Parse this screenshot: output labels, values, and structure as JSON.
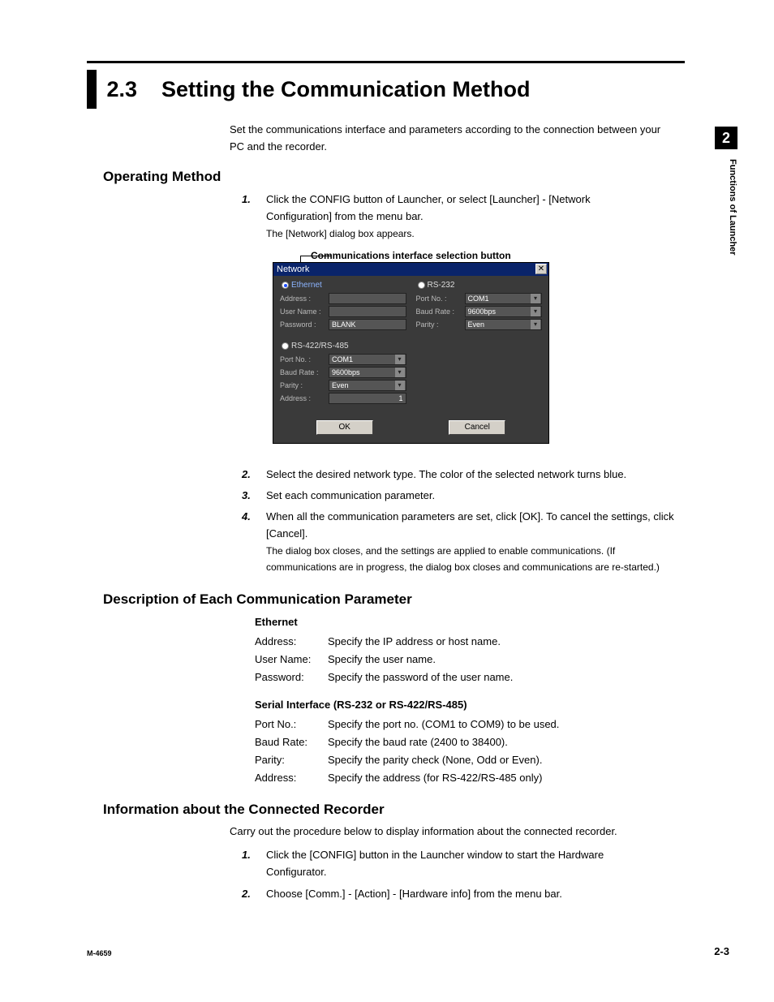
{
  "section_number": "2.3",
  "section_title": "Setting the Communication Method",
  "intro": "Set the communications interface and parameters according to the connection between your PC and the recorder.",
  "side_tab": "2",
  "side_label": "Functions of Launcher",
  "operating_method": {
    "heading": "Operating Method",
    "steps": [
      {
        "num": "1.",
        "text": "Click the CONFIG button of Launcher, or select [Launcher] - [Network Configuration] from the menu bar.",
        "note": "The [Network] dialog box appears."
      },
      {
        "num": "2.",
        "text": "Select the desired network type.  The color of the selected network turns blue."
      },
      {
        "num": "3.",
        "text": "Set each communication parameter."
      },
      {
        "num": "4.",
        "text": "When all the communication parameters are set, click [OK].  To cancel the settings, click [Cancel].",
        "note": "The dialog box closes, and the settings are applied to enable communications.  (If communications are in progress, the dialog box closes and communications are re-started.)"
      }
    ]
  },
  "callout": "Communications interface selection button",
  "dialog": {
    "title": "Network",
    "ethernet": {
      "title": "Ethernet",
      "address_label": "Address :",
      "address_value": "",
      "username_label": "User Name :",
      "username_value": "",
      "password_label": "Password :",
      "password_value": "BLANK"
    },
    "rs422": {
      "title": "RS-422/RS-485",
      "portno_label": "Port No. :",
      "portno_value": "COM1",
      "baud_label": "Baud Rate :",
      "baud_value": "9600bps",
      "parity_label": "Parity :",
      "parity_value": "Even",
      "address_label": "Address :",
      "address_value": "1"
    },
    "rs232": {
      "title": "RS-232",
      "portno_label": "Port No. :",
      "portno_value": "COM1",
      "baud_label": "Baud Rate :",
      "baud_value": "9600bps",
      "parity_label": "Parity :",
      "parity_value": "Even"
    },
    "ok": "OK",
    "cancel": "Cancel"
  },
  "desc_heading": "Description of Each Communication Parameter",
  "ethernet_params": {
    "title": "Ethernet",
    "rows": [
      {
        "key": "Address:",
        "val": "Specify the IP address or host name."
      },
      {
        "key": "User Name:",
        "val": "Specify the user name."
      },
      {
        "key": "Password:",
        "val": "Specify the password of the user name."
      }
    ]
  },
  "serial_params": {
    "title": "Serial Interface (RS-232 or RS-422/RS-485)",
    "rows": [
      {
        "key": "Port No.:",
        "val": "Specify the port no. (COM1 to COM9) to be used."
      },
      {
        "key": "Baud Rate:",
        "val": "Specify the baud rate (2400 to 38400)."
      },
      {
        "key": "Parity:",
        "val": "Specify the parity check (None, Odd or Even)."
      },
      {
        "key": "Address:",
        "val": "Specify the address (for RS-422/RS-485 only)"
      }
    ]
  },
  "info": {
    "heading": "Information about the Connected Recorder",
    "intro": "Carry out the procedure below to display information about the connected recorder.",
    "steps": [
      {
        "num": "1.",
        "text": "Click the [CONFIG] button in the Launcher window to start the Hardware Configurator."
      },
      {
        "num": "2.",
        "text": "Choose [Comm.] - [Action] - [Hardware info] from the menu bar."
      }
    ]
  },
  "footer_left": "M-4659",
  "footer_right": "2-3"
}
